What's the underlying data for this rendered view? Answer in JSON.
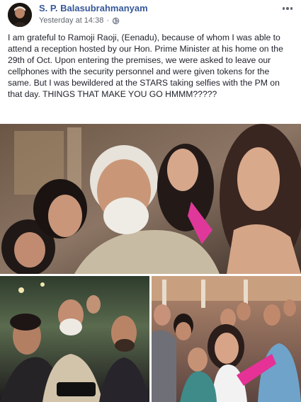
{
  "post": {
    "author": "S. P. Balasubrahmanyam",
    "timestamp": "Yesterday at 14:38",
    "separator": "·",
    "privacy_icon": "globe-icon",
    "menu_icon": "more-options-icon",
    "text": "I am grateful to Ramoji Raoji, (Eenadu), because of whom I was able to attend a reception hosted by our Hon. Prime Minister at his home on the 29th of Oct. Upon entering the premises, we were asked to leave our cellphones with the security personnel and were given tokens for the same. But I was bewildered at the STARS taking selfies with the PM on that day. THINGS THAT MAKE YOU GO HMMM?????"
  },
  "photos": {
    "main": {
      "icon": "group-selfie-photo"
    },
    "bottom_left": {
      "icon": "group-selfie-photo"
    },
    "bottom_right": {
      "icon": "group-selfie-photo"
    }
  },
  "colors": {
    "author_link": "#365899",
    "meta_text": "#616770",
    "body_text": "#1d2129"
  }
}
